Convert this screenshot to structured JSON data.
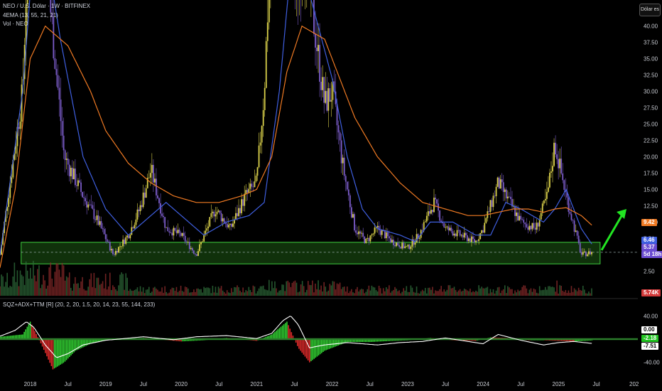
{
  "header": {
    "symbol_line": "NEO / U.S. Dólar · 1W · BITFINEX",
    "ema_line": "4EMA (13, 55, 21, 21)",
    "vol_line": "Vol · NEO",
    "indicator_line": "SQZ+ADX+TTM [R] (20, 2, 20, 1.5, 20, 14, 23, 55, 144, 233)",
    "currency_button": "Dólar es"
  },
  "colors": {
    "background": "#000000",
    "candle_up": "#d9d04a",
    "candle_down": "#7b5cc9",
    "ema_fast": "#3f5fe0",
    "ema_slow": "#f07a23",
    "support_zone": "#2e8b1f",
    "arrow": "#22e522",
    "squeeze_up": "#33d633",
    "squeeze_down": "#e02a2a",
    "adx_line": "#ffffff"
  },
  "tags": {
    "ema_slow_value": "9.42",
    "ema_fast_value": "6.46",
    "price_value": "5.37",
    "countdown": "5d 18h",
    "volume_value": "5.74K",
    "ind_top": "0.00",
    "ind_green": "-2.18",
    "ind_white": "-7.51"
  },
  "chart_data": [
    {
      "type": "line",
      "title": "NEO / U.S. Dólar · 1W · BITFINEX",
      "y_ticks": [
        "2.50",
        "5.00",
        "7.50",
        "10.00",
        "12.50",
        "15.00",
        "17.50",
        "20.00",
        "22.50",
        "25.00",
        "27.50",
        "30.00",
        "32.50",
        "35.00",
        "37.50",
        "40.00"
      ],
      "x_ticks": [
        "2018",
        "Jul",
        "2019",
        "Jul",
        "2020",
        "Jul",
        "2021",
        "Jul",
        "2022",
        "Jul",
        "2023",
        "Jul",
        "2024",
        "Jul",
        "2025",
        "Jul",
        "202"
      ],
      "ylim": [
        -1.5,
        44
      ],
      "series": [
        {
          "name": "price",
          "x": [
            2017.6,
            2017.9,
            2018.05,
            2018.25,
            2018.45,
            2018.7,
            2018.9,
            2019.1,
            2019.3,
            2019.45,
            2019.6,
            2019.8,
            2020.0,
            2020.2,
            2020.45,
            2020.65,
            2020.85,
            2021.0,
            2021.1,
            2021.25,
            2021.35,
            2021.5,
            2021.65,
            2021.9,
            2022.0,
            2022.15,
            2022.3,
            2022.45,
            2022.6,
            2022.8,
            2023.0,
            2023.15,
            2023.35,
            2023.5,
            2023.7,
            2023.9,
            2024.0,
            2024.2,
            2024.35,
            2024.5,
            2024.7,
            2024.85,
            2024.95,
            2025.1,
            2025.3,
            2025.45
          ],
          "y": [
            5,
            30,
            80,
            45,
            20,
            14,
            10,
            5,
            8,
            12,
            18,
            9,
            8,
            5,
            12,
            9,
            14,
            16,
            30,
            70,
            80,
            45,
            50,
            28,
            30,
            18,
            9,
            7,
            9,
            7,
            6,
            8,
            13,
            9,
            8,
            7,
            9,
            16,
            13,
            10,
            9,
            14,
            22,
            14,
            5,
            5.4
          ]
        },
        {
          "name": "EMA fast",
          "x": [
            2017.6,
            2017.9,
            2018.1,
            2018.4,
            2018.7,
            2019.0,
            2019.3,
            2019.5,
            2019.8,
            2020.1,
            2020.3,
            2020.6,
            2020.9,
            2021.1,
            2021.3,
            2021.5,
            2021.7,
            2022.0,
            2022.2,
            2022.4,
            2022.6,
            2022.9,
            2023.1,
            2023.3,
            2023.6,
            2023.9,
            2024.1,
            2024.3,
            2024.5,
            2024.8,
            2024.95,
            2025.1,
            2025.3,
            2025.45
          ],
          "y": [
            5,
            30,
            60,
            38,
            20,
            12,
            8,
            10,
            13,
            10,
            8,
            10,
            11,
            13,
            30,
            55,
            45,
            32,
            20,
            12,
            9,
            8,
            7,
            10,
            10,
            8,
            8,
            13,
            12,
            10,
            12,
            15,
            9,
            6.46
          ]
        },
        {
          "name": "EMA slow",
          "x": [
            2017.6,
            2017.8,
            2018.0,
            2018.2,
            2018.5,
            2018.8,
            2019.0,
            2019.3,
            2019.6,
            2019.9,
            2020.2,
            2020.5,
            2020.8,
            2021.0,
            2021.2,
            2021.4,
            2021.6,
            2021.9,
            2022.1,
            2022.3,
            2022.6,
            2022.9,
            2023.2,
            2023.5,
            2023.8,
            2024.0,
            2024.2,
            2024.4,
            2024.6,
            2024.8,
            2024.95,
            2025.1,
            2025.3,
            2025.45
          ],
          "y": [
            3,
            15,
            35,
            40,
            37,
            30,
            24,
            19,
            16,
            14,
            13,
            13,
            14,
            15,
            20,
            33,
            40,
            38,
            32,
            26,
            20,
            16,
            13,
            12,
            11,
            11,
            11.5,
            12,
            12,
            11.5,
            12,
            12.2,
            11,
            9.42
          ]
        }
      ]
    },
    {
      "type": "area",
      "title": "SQZ+ADX+TTM [R] (20, 2, 20, 1.5, 20, 14, 23, 55, 144, 233)",
      "y_ticks": [
        "40.00",
        "-40.00"
      ],
      "ylim": [
        -55,
        55
      ],
      "series": [
        {
          "name": "momentum",
          "x": [
            2017.6,
            2017.9,
            2018.0,
            2018.15,
            2018.3,
            2018.45,
            2018.6,
            2018.8,
            2019.0,
            2019.5,
            2020.0,
            2020.3,
            2020.6,
            2021.0,
            2021.2,
            2021.4,
            2021.55,
            2021.7,
            2021.9,
            2022.2,
            2022.5,
            2022.8,
            2023.0,
            2023.3,
            2023.6,
            2023.9,
            2024.1,
            2024.3,
            2024.6,
            2024.8,
            2025.0,
            2025.2,
            2025.45
          ],
          "y": [
            4,
            8,
            30,
            -10,
            -52,
            -40,
            -20,
            -8,
            -2,
            2,
            -4,
            -2,
            2,
            -3,
            8,
            30,
            -15,
            -40,
            -20,
            -5,
            -5,
            -3,
            -2,
            2,
            -2,
            -3,
            3,
            2,
            -2,
            -2,
            -3,
            -4,
            -2.18
          ]
        },
        {
          "name": "ADX",
          "x": [
            2017.6,
            2017.8,
            2017.95,
            2018.05,
            2018.2,
            2018.35,
            2018.5,
            2018.7,
            2019.0,
            2019.5,
            2019.9,
            2020.2,
            2020.6,
            2021.0,
            2021.2,
            2021.35,
            2021.45,
            2021.55,
            2021.7,
            2021.9,
            2022.2,
            2022.6,
            2022.9,
            2023.2,
            2023.5,
            2023.8,
            2024.0,
            2024.2,
            2024.5,
            2024.8,
            2025.0,
            2025.2,
            2025.45
          ],
          "y": [
            5,
            15,
            30,
            20,
            -10,
            -32,
            -25,
            -10,
            -2,
            4,
            -1,
            4,
            6,
            1,
            10,
            32,
            40,
            25,
            -15,
            -10,
            -6,
            -10,
            -6,
            -4,
            2,
            -4,
            -8,
            8,
            -2,
            -10,
            -6,
            -4,
            -7.51
          ]
        }
      ]
    }
  ]
}
